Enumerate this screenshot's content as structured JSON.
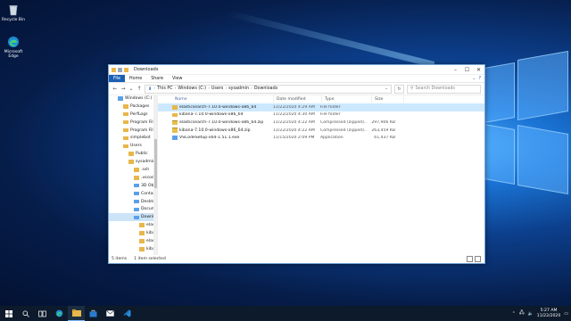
{
  "desktop": {
    "icons": [
      {
        "label": "Recycle Bin",
        "icon": "recycle-bin-icon"
      },
      {
        "label": "Microsoft Edge",
        "icon": "edge-icon"
      }
    ]
  },
  "window": {
    "title": "Downloads",
    "tabs": [
      "File",
      "Home",
      "Share",
      "View"
    ],
    "address": [
      "This PC",
      "Windows (C:)",
      "Users",
      "sysadmin",
      "Downloads"
    ],
    "search_placeholder": "Search Downloads"
  },
  "nav_tree": [
    {
      "label": "Windows (C:)",
      "icon": "drive-icon"
    },
    {
      "label": "Packages",
      "icon": "folder-icon"
    },
    {
      "label": "PerfLogs",
      "icon": "folder-icon"
    },
    {
      "label": "Program Files",
      "icon": "folder-icon"
    },
    {
      "label": "Program Files",
      "icon": "folder-icon"
    },
    {
      "label": "simplebot",
      "icon": "folder-icon"
    },
    {
      "label": "Users",
      "icon": "folder-icon"
    },
    {
      "label": "Public",
      "icon": "folder-icon"
    },
    {
      "label": "sysadmin",
      "icon": "folder-icon"
    },
    {
      "label": ".ssh",
      "icon": "folder-icon"
    },
    {
      "label": ".vscode",
      "icon": "folder-icon"
    },
    {
      "label": "3D Objects",
      "icon": "3d-objects-icon"
    },
    {
      "label": "Contacts",
      "icon": "contacts-icon"
    },
    {
      "label": "Desktop",
      "icon": "desktop-folder-icon"
    },
    {
      "label": "Documents",
      "icon": "documents-icon"
    },
    {
      "label": "Downloads",
      "icon": "downloads-icon",
      "selected": true
    },
    {
      "label": "elasticsearch",
      "icon": "folder-icon"
    },
    {
      "label": "kibana-7.1",
      "icon": "folder-icon"
    },
    {
      "label": "elasticsearch",
      "icon": "folder-icon"
    },
    {
      "label": "kibana-7.1",
      "icon": "folder-icon"
    }
  ],
  "columns": [
    "Name",
    "Date modified",
    "Type",
    "Size"
  ],
  "files": [
    {
      "name": "elasticsearch-7.10.0-windows-x86_64",
      "date": "11/22/2020 4:29 AM",
      "type": "File folder",
      "size": "",
      "icon": "folder-icon",
      "selected": true
    },
    {
      "name": "kibana-7.10.0-windows-x86_64",
      "date": "11/22/2020 4:30 AM",
      "type": "File folder",
      "size": "",
      "icon": "folder-icon"
    },
    {
      "name": "elasticsearch-7.10.0-windows-x86_64.zip",
      "date": "11/22/2020 4:22 AM",
      "type": "Compressed (zipped)...",
      "size": "297,906 KB",
      "icon": "zip-icon"
    },
    {
      "name": "kibana-7.10.0-windows-x86_64.zip",
      "date": "11/22/2020 4:22 AM",
      "type": "Compressed (zipped)...",
      "size": "263,459 KB",
      "icon": "zip-icon"
    },
    {
      "name": "VSCodeSetup-x64-1.51.1.exe",
      "date": "11/15/2020 2:09 PM",
      "type": "Application",
      "size": "61,437 KB",
      "icon": "vscode-setup-icon"
    }
  ],
  "status": {
    "count": "5 items",
    "selected": "1 item selected"
  },
  "taskbar": {
    "apps": [
      "start-icon",
      "search-icon",
      "task-view-icon",
      "edge-icon",
      "file-explorer-icon",
      "store-icon",
      "mail-icon",
      "vscode-icon"
    ],
    "time": "5:27 AM",
    "date": "11/22/2020"
  }
}
